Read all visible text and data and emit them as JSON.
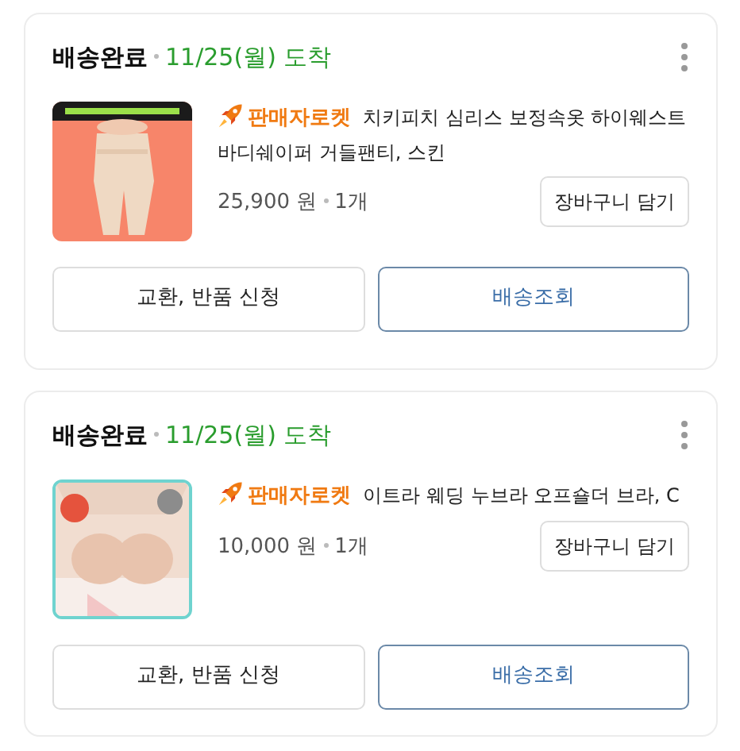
{
  "orders": [
    {
      "status": "배송완료",
      "arrival": "11/25(월) 도착",
      "seller_badge": "판매자로켓",
      "product": "치키피치 심리스 보정속옷 하이웨스트 바디쉐이퍼 거들팬티, 스킨",
      "price": "25,900 원",
      "quantity": "1개",
      "cart_button": "장바구니 담기",
      "actions": [
        "교환, 반품 신청",
        "배송조회"
      ]
    },
    {
      "status": "배송완료",
      "arrival": "11/25(월) 도착",
      "seller_badge": "판매자로켓",
      "product": "이트라 웨딩 누브라 오프숄더 브라, C",
      "price": "10,000 원",
      "quantity": "1개",
      "cart_button": "장바구니 담기",
      "actions": [
        "교환, 반품 신청",
        "배송조회"
      ]
    }
  ]
}
